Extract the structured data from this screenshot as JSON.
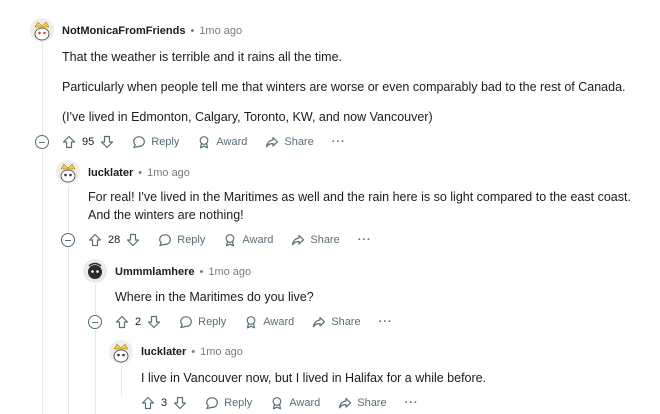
{
  "comments": [
    {
      "author": "NotMonicaFromFriends",
      "time": "1mo ago",
      "paragraphs": [
        "That the weather is terrible and it rains all the time.",
        "Particularly when people tell me that winters are worse or even comparably bad to the rest of Canada.",
        "(I've lived in Edmonton, Calgary, Toronto, KW, and now Vancouver)"
      ],
      "votes": "95"
    },
    {
      "author": "lucklater",
      "time": "1mo ago",
      "paragraphs": [
        "For real! I've lived in the Maritimes as well and the rain here is so light compared to the east coast. And the winters are nothing!"
      ],
      "votes": "28"
    },
    {
      "author": "Ummmlamhere",
      "time": "1mo ago",
      "paragraphs": [
        "Where in the Maritimes do you live?"
      ],
      "votes": "2"
    },
    {
      "author": "lucklater",
      "time": "1mo ago",
      "paragraphs": [
        "I live in Vancouver now, but I lived in Halifax for a while before."
      ],
      "votes": "3"
    }
  ],
  "actions": {
    "reply_label": "Reply",
    "award_label": "Award",
    "share_label": "Share",
    "more_label": "···"
  },
  "separator": "•",
  "colors": {
    "meta_gray": "#7c7c7c",
    "action_gray": "#576f76",
    "thread_line": "#e5e7e9"
  }
}
